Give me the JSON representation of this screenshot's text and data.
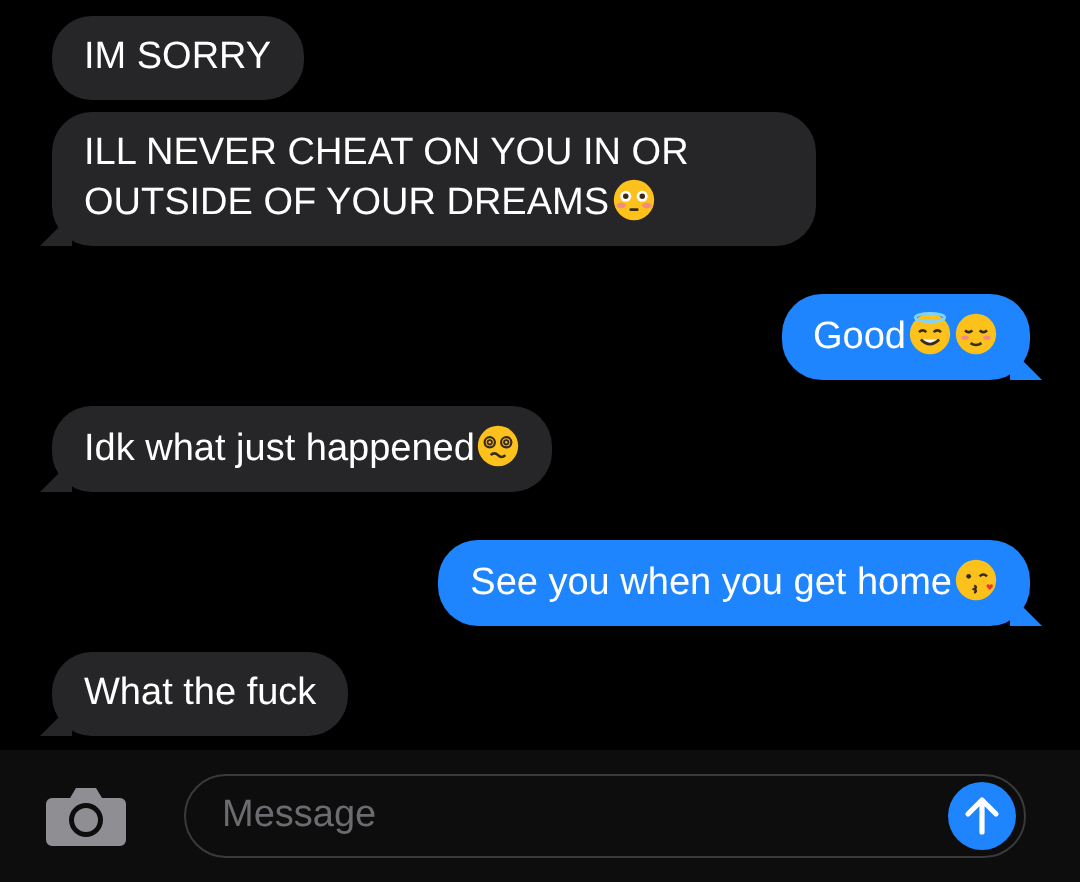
{
  "messages": [
    {
      "kind": "received",
      "text": "IM SORRY"
    },
    {
      "kind": "received",
      "text": "ILL NEVER CHEAT ON YOU IN OR OUTSIDE OF YOUR DREAMS",
      "icons": [
        {
          "kind": "flushed"
        }
      ]
    },
    {
      "kind": "sent",
      "text": "Good",
      "icons": [
        {
          "kind": "halo"
        },
        {
          "kind": "relieved"
        }
      ]
    },
    {
      "kind": "received",
      "text": "Idk what just happened",
      "icons": [
        {
          "kind": "dizzy"
        }
      ]
    },
    {
      "kind": "sent",
      "text": "See you when you get home",
      "icons": [
        {
          "kind": "kiss"
        }
      ]
    },
    {
      "kind": "received",
      "text": "What the fuck"
    }
  ],
  "composer": {
    "placeholder": "Message"
  }
}
